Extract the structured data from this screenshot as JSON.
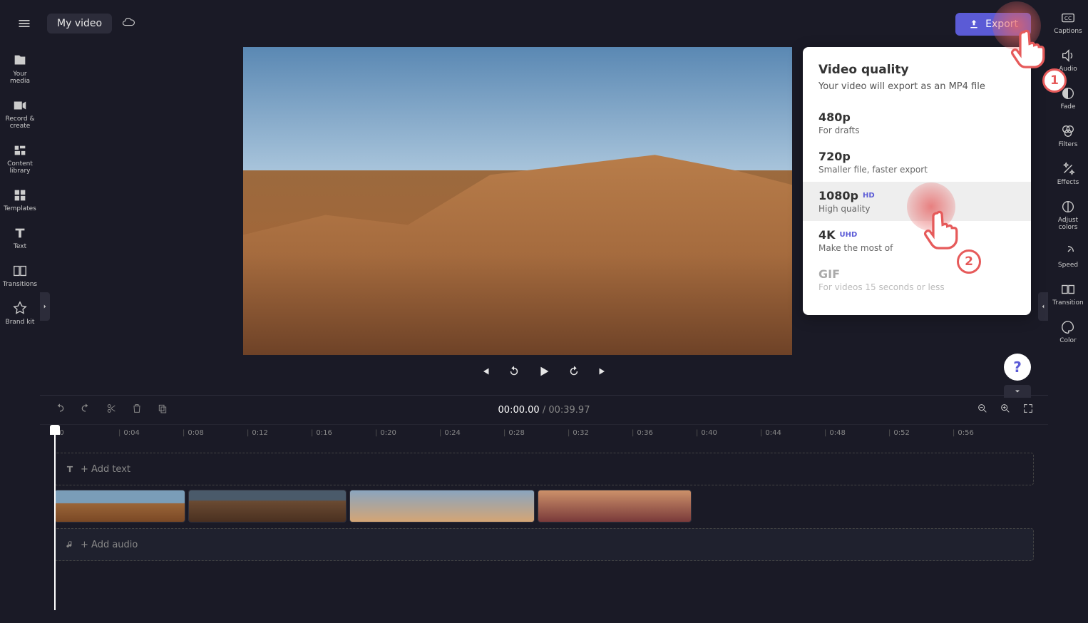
{
  "topbar": {
    "project_name": "My video",
    "export_label": "Export"
  },
  "left_sidebar": {
    "your_media": "Your media",
    "record_create": "Record & create",
    "content_library": "Content library",
    "templates": "Templates",
    "text": "Text",
    "transitions": "Transitions",
    "brand_kit": "Brand kit"
  },
  "right_sidebar": {
    "captions": "Captions",
    "audio": "Audio",
    "fade": "Fade",
    "filters": "Filters",
    "effects": "Effects",
    "adjust_colors": "Adjust colors",
    "speed": "Speed",
    "transition": "Transition",
    "color": "Color"
  },
  "export_popup": {
    "title": "Video quality",
    "subtitle": "Your video will export as an MP4 file",
    "options": [
      {
        "label": "480p",
        "desc": "For drafts",
        "badge": ""
      },
      {
        "label": "720p",
        "desc": "Smaller file, faster export",
        "badge": ""
      },
      {
        "label": "1080p",
        "desc": "High quality",
        "badge": "HD"
      },
      {
        "label": "4K",
        "desc": "Make the most of",
        "badge": "UHD"
      },
      {
        "label": "GIF",
        "desc": "For videos 15 seconds or less",
        "badge": ""
      }
    ]
  },
  "timeline": {
    "current_time": "00:00.00",
    "total_time": "00:39.97",
    "add_text_label": "+ Add text",
    "add_audio_label": "+ Add audio",
    "ruler_marks": [
      "0",
      "0:04",
      "0:08",
      "0:12",
      "0:16",
      "0:20",
      "0:24",
      "0:28",
      "0:32",
      "0:36",
      "0:40",
      "0:44",
      "0:48",
      "0:52",
      "0:56"
    ]
  },
  "annotations": {
    "step1": "1",
    "step2": "2"
  },
  "help_label": "?"
}
